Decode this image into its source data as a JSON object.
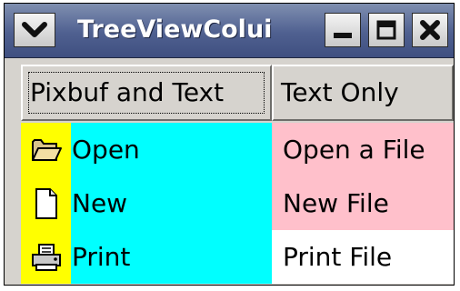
{
  "window": {
    "title": "TreeViewColumn Example",
    "title_visible": "TreeViewColui"
  },
  "columns": [
    {
      "label": "Pixbuf and Text"
    },
    {
      "label": "Text Only"
    }
  ],
  "rows": [
    {
      "icon": "folder-open-icon",
      "label": "Open",
      "description": "Open a File",
      "desc_bg": "#ffc0cb"
    },
    {
      "icon": "new-file-icon",
      "label": "New",
      "description": "New File",
      "desc_bg": "#ffc0cb"
    },
    {
      "icon": "printer-icon",
      "label": "Print",
      "description": "Print File",
      "desc_bg": "#ffffff"
    }
  ],
  "colors": {
    "icon_cell_bg": "#ffff00",
    "label_cell_bg": "#00ffff",
    "titlebar": "#4f6090"
  }
}
